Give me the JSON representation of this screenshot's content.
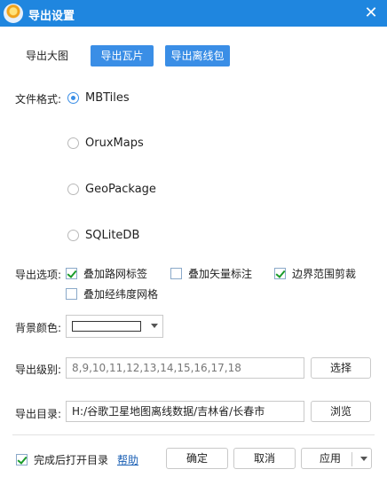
{
  "window": {
    "title": "导出设置",
    "close": "✕",
    "accent": "#1f86df"
  },
  "tabs": {
    "big_image": "导出大图",
    "tiles": "导出瓦片",
    "offline_pack": "导出离线包"
  },
  "format": {
    "label": "文件格式:",
    "options": [
      "MBTiles",
      "OruxMaps",
      "GeoPackage",
      "SQLiteDB"
    ],
    "selected": "MBTiles"
  },
  "export_options": {
    "label": "导出选项:",
    "items": [
      {
        "label": "叠加路网标签",
        "checked": true
      },
      {
        "label": "叠加矢量标注",
        "checked": false
      },
      {
        "label": "边界范围剪裁",
        "checked": true
      },
      {
        "label": "叠加经纬度网格",
        "checked": false
      }
    ]
  },
  "background": {
    "label": "背景颜色:",
    "color": "#ffffff"
  },
  "levels": {
    "label": "导出级别:",
    "value": "8,9,10,11,12,13,14,15,16,17,18",
    "button": "选择"
  },
  "directory": {
    "label": "导出目录:",
    "value": "H:/谷歌卫星地图离线数据/吉林省/长春市",
    "button": "浏览"
  },
  "footer": {
    "open_after": "完成后打开目录",
    "open_after_checked": true,
    "help": "帮助",
    "ok": "确定",
    "cancel": "取消",
    "apply": "应用"
  }
}
